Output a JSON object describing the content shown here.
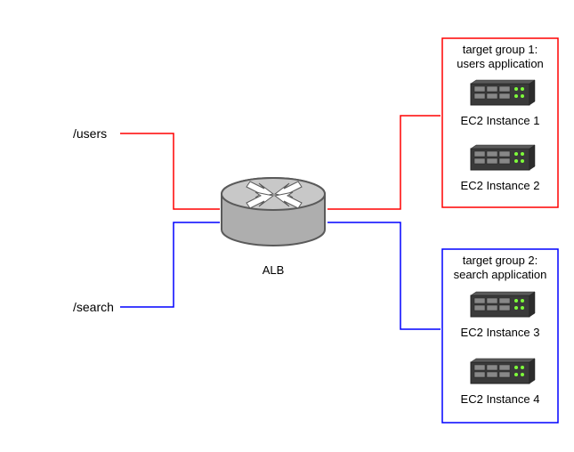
{
  "routes": {
    "users": "/users",
    "search": "/search"
  },
  "lb": {
    "label": "ALB"
  },
  "groups": {
    "g1": {
      "title1": "target group 1:",
      "title2": "users application"
    },
    "g2": {
      "title1": "target group 2:",
      "title2": "search application"
    }
  },
  "instances": {
    "i1": "EC2 Instance 1",
    "i2": "EC2 Instance 2",
    "i3": "EC2 Instance 3",
    "i4": "EC2 Instance 4"
  },
  "colors": {
    "red": "#ff0000",
    "blue": "#0000ff",
    "routerFill": "#b8b8b8",
    "routerStroke": "#5a5a5a",
    "serverBody": "#3a3a3a",
    "serverLight": "#888888",
    "led": "#7eff3a"
  }
}
